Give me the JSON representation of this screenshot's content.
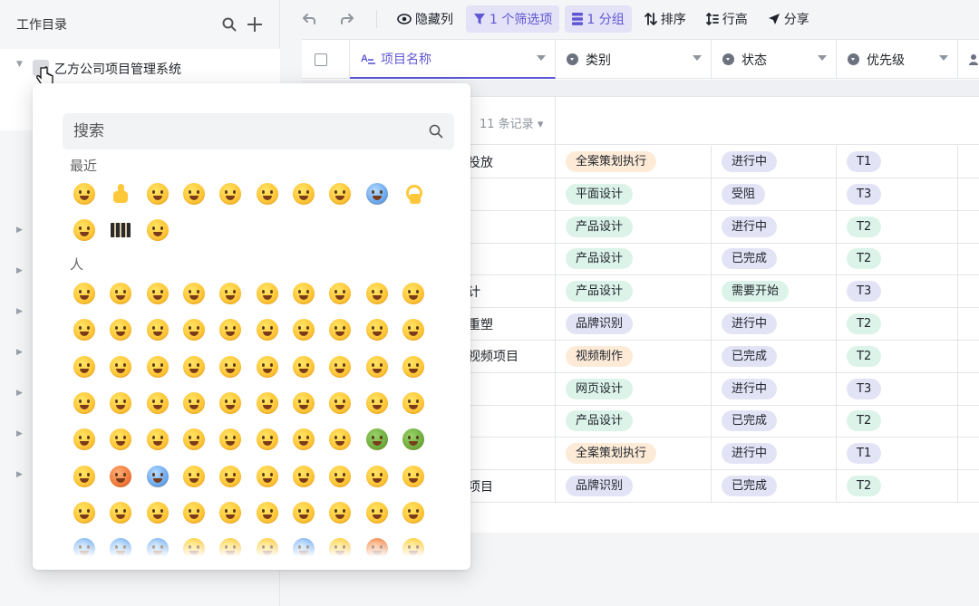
{
  "sidebar": {
    "title": "工作目录",
    "workspace_name": "乙方公司项目管理系统"
  },
  "toolbar": {
    "hide_columns": "隐藏列",
    "filter": "1 个筛选项",
    "group": "1 分组",
    "sort": "排序",
    "row_height": "行高",
    "share": "分享"
  },
  "table": {
    "columns": [
      "项目名称",
      "类别",
      "状态",
      "优先级"
    ],
    "group_count": "11 条记录",
    "rows": [
      {
        "name": "投放",
        "category": "全案策划执行",
        "status": "进行中",
        "priority": "T1"
      },
      {
        "name": "",
        "category": "平面设计",
        "status": "受阻",
        "priority": "T3"
      },
      {
        "name": "",
        "category": "产品设计",
        "status": "进行中",
        "priority": "T2"
      },
      {
        "name": "",
        "category": "产品设计",
        "status": "已完成",
        "priority": "T2"
      },
      {
        "name": "计",
        "category": "产品设计",
        "status": "需要开始",
        "priority": "T3"
      },
      {
        "name": "重塑",
        "category": "品牌识别",
        "status": "进行中",
        "priority": "T2"
      },
      {
        "name": "视频项目",
        "category": "视频制作",
        "status": "已完成",
        "priority": "T2"
      },
      {
        "name": "",
        "category": "网页设计",
        "status": "进行中",
        "priority": "T3"
      },
      {
        "name": "",
        "category": "产品设计",
        "status": "已完成",
        "priority": "T2"
      },
      {
        "name": "",
        "category": "全案策划执行",
        "status": "进行中",
        "priority": "T1"
      },
      {
        "name": "项目",
        "category": "品牌识别",
        "status": "已完成",
        "priority": "T2"
      }
    ]
  },
  "tag_colors": {
    "category": {
      "全案策划执行": "#fdebd8",
      "平面设计": "#dcf3ea",
      "产品设计": "#dcf3ea",
      "品牌识别": "#e3e3f6",
      "视频制作": "#fdebd8",
      "网页设计": "#dcf3ea"
    },
    "status": {
      "进行中": "#e3e3f6",
      "受阻": "#e3e3f6",
      "已完成": "#e3e3f6",
      "需要开始": "#dcf3ea"
    },
    "priority": {
      "T1": "#e3e3f6",
      "T2": "#dcf3ea",
      "T3": "#e3e3f6"
    }
  },
  "emoji_picker": {
    "search_placeholder": "搜索",
    "recent_title": "最近",
    "people_title": "人",
    "recent": [
      "grinning-face",
      "thumbs-up",
      "winking-face-tongue",
      "heart-eyes",
      "squinting-laugh",
      "zany-face",
      "grinning-sweat",
      "tears-of-joy",
      "screaming-face",
      "ok-hand",
      "beaming-face",
      "chequered-flag",
      "disappointed-face"
    ],
    "people": [
      "grinning-face",
      "grinning-big-eyes",
      "grinning-smiling-eyes",
      "beaming-face",
      "squinting-laugh",
      "grinning-sweat",
      "rolling-laughing",
      "tears-of-joy",
      "slightly-smiling",
      "upside-down",
      "winking-face",
      "smiling-eyes",
      "halo-face",
      "hearts-face",
      "heart-eyes",
      "star-struck",
      "kissing-face",
      "kissing-closed",
      "relaxed-face",
      "kissing-smiling",
      "yum-face",
      "tongue-face",
      "winking-tongue",
      "zany-face",
      "squinting-tongue",
      "money-mouth",
      "hugging-face",
      "hand-over-mouth",
      "shushing-face",
      "thinking-face",
      "zipper-mouth",
      "raised-eyebrow",
      "neutral-face",
      "expressionless",
      "no-mouth",
      "smirking-face",
      "unamused-face",
      "rolling-eyes",
      "grimacing-face",
      "lying-face",
      "relieved-face",
      "pensive-face",
      "sleepy-face",
      "drooling-face",
      "sleeping-face",
      "mask-face",
      "thermometer-face",
      "bandage-face",
      "nauseated-face",
      "vomiting-face",
      "sneezing-face",
      "hot-face",
      "cold-face",
      "woozy-face",
      "dizzy-face",
      "exploding-head",
      "cowboy-face",
      "partying-face",
      "sunglasses-face",
      "nerd-face",
      "monocle-face",
      "confused-face",
      "worried-face",
      "frowning-face",
      "open-mouth",
      "hushed-face",
      "astonished-face",
      "flushed-face",
      "pleading-face",
      "frowning-open",
      "anguished-face",
      "fearful-face",
      "anxious-sweat",
      "sad-relieved",
      "crying-face",
      "loudly-crying",
      "screaming-face",
      "confounded-face",
      "persevering-face",
      "disappointed-face"
    ]
  }
}
